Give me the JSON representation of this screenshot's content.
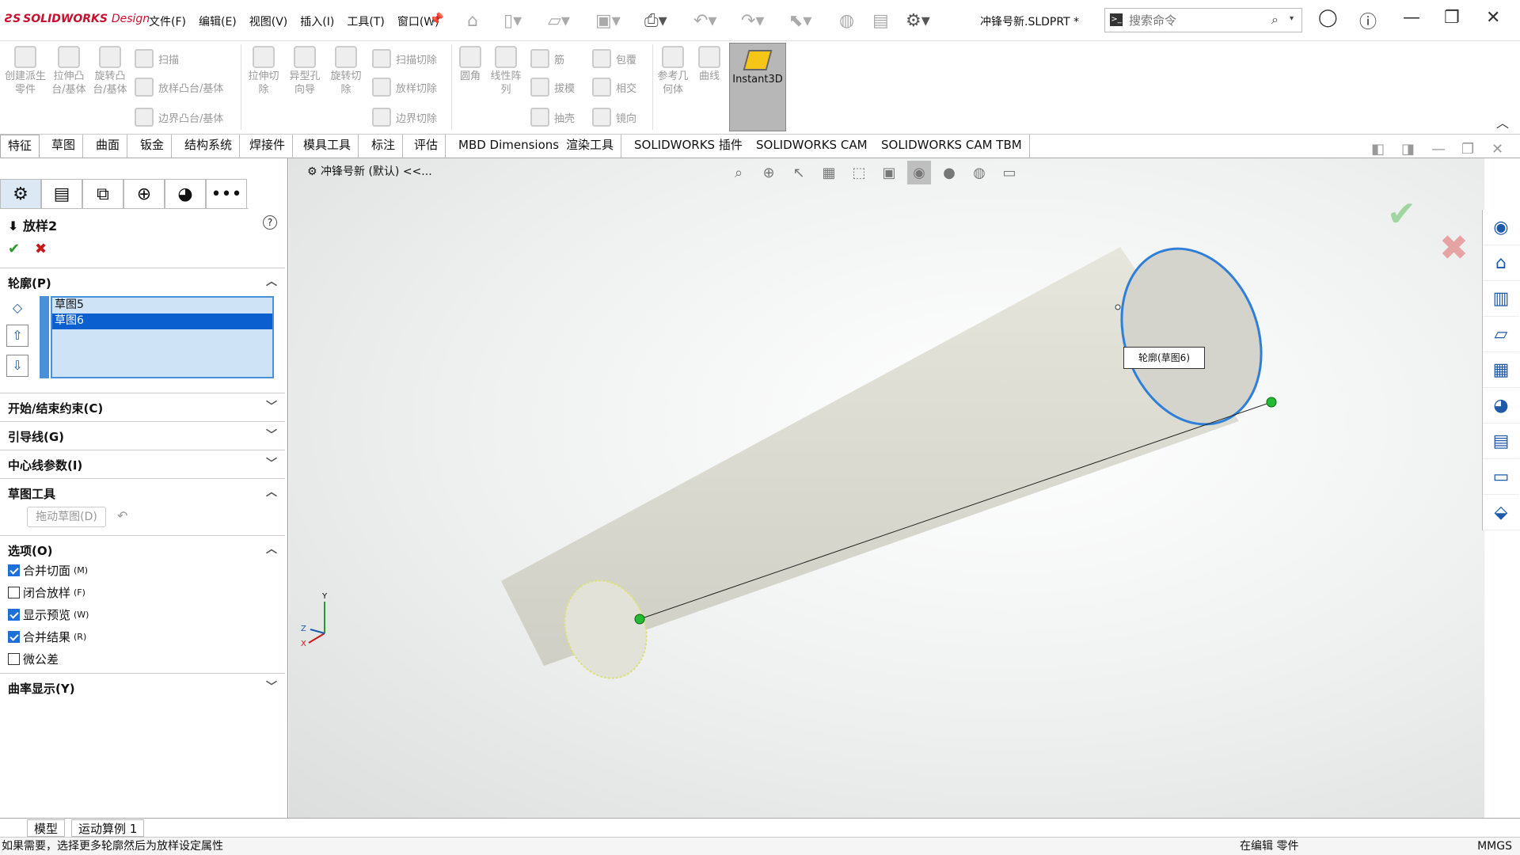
{
  "app": {
    "logo": "SOLIDWORKS",
    "logo_sub": "Design",
    "document_title": "冲锋号新.SLDPRT *"
  },
  "menus": [
    "文件(F)",
    "编辑(E)",
    "视图(V)",
    "插入(I)",
    "工具(T)",
    "窗口(W)"
  ],
  "search": {
    "placeholder": "搜索命令"
  },
  "ribbon": {
    "buttons": [
      "创建派生零件",
      "拉伸凸台/基体",
      "旋转凸台/基体",
      "拉伸切除",
      "异型孔向导",
      "旋转切除",
      "圆角",
      "线性阵列",
      "参考几何体",
      "曲线"
    ],
    "small_buttons": [
      "扫描",
      "放样凸台/基体",
      "边界凸台/基体",
      "扫描切除",
      "放样切除",
      "边界切除",
      "筋",
      "拔模",
      "抽壳",
      "包覆",
      "相交",
      "镜向"
    ],
    "instant3d": "Instant3D"
  },
  "tabs": [
    "特征",
    "草图",
    "曲面",
    "钣金",
    "结构系统",
    "焊接件",
    "模具工具",
    "标注",
    "评估",
    "MBD Dimensions",
    "渲染工具",
    "SOLIDWORKS 插件",
    "SOLIDWORKS CAM",
    "SOLIDWORKS CAM TBM"
  ],
  "property_manager": {
    "title": "放样2",
    "sections": {
      "profile": "轮廓(P)",
      "start_end": "开始/结束约束(C)",
      "guides": "引导线(G)",
      "centerline": "中心线参数(I)",
      "sketch_tools": "草图工具",
      "options": "选项(O)",
      "curvature": "曲率显示(Y)"
    },
    "profiles": [
      "草图5",
      "草图6"
    ],
    "drag_sketch": "拖动草图(D)",
    "options": [
      {
        "label": "合并切面",
        "key": "(M)",
        "checked": true
      },
      {
        "label": "闭合放样",
        "key": "(F)",
        "checked": false
      },
      {
        "label": "显示预览",
        "key": "(W)",
        "checked": true
      },
      {
        "label": "合并结果",
        "key": "(R)",
        "checked": true
      },
      {
        "label": "微公差",
        "key": "",
        "checked": false
      }
    ]
  },
  "viewport": {
    "breadcrumb": "冲锋号新 (默认) <<...",
    "tooltip": "轮廓(草图6)"
  },
  "bottom_tabs": [
    "模型",
    "运动算例 1"
  ],
  "status": {
    "message": "如果需要，选择更多轮廓然后为放样设定属性",
    "editing": "在编辑 零件",
    "units": "MMGS"
  },
  "colors": {
    "accent": "#1e6fd6",
    "brand": "#c8102e",
    "profile_edge": "#2f7fd8",
    "point": "#22bb33"
  }
}
